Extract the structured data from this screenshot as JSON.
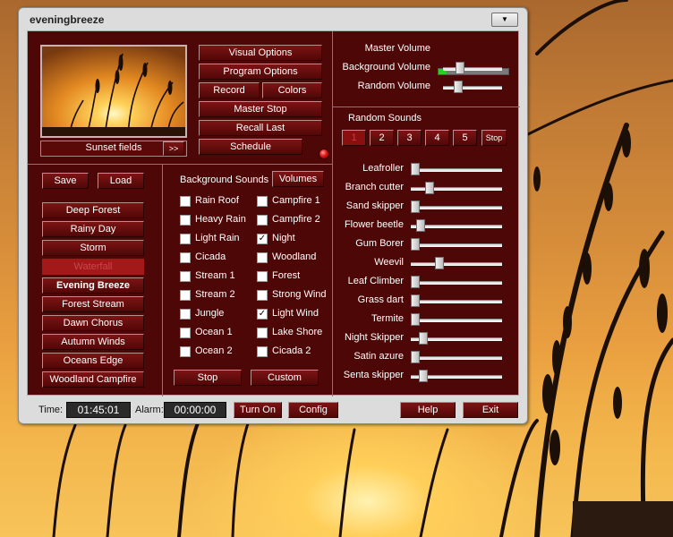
{
  "window": {
    "title": "eveningbreeze",
    "menu_glyph": "▼"
  },
  "preview": {
    "label": "Sunset fields",
    "next_label": ">>"
  },
  "options": {
    "visual": "Visual Options",
    "program": "Program Options",
    "record": "Record",
    "colors": "Colors",
    "master_stop": "Master Stop",
    "recall_last": "Recall Last",
    "schedule": "Schedule"
  },
  "volume": {
    "master_label": "Master Volume",
    "background_label": "Background Volume",
    "random_label": "Random Volume",
    "master_level": 0.12,
    "background_level": 0.25,
    "random_level": 0.22
  },
  "random_sounds": {
    "title": "Random Sounds",
    "presets": [
      "1",
      "2",
      "3",
      "4",
      "5"
    ],
    "stop_label": "Stop",
    "items": [
      {
        "label": "Leafroller",
        "level": 0.0
      },
      {
        "label": "Branch cutter",
        "level": 0.17
      },
      {
        "label": "Sand skipper",
        "level": 0.0
      },
      {
        "label": "Flower beetle",
        "level": 0.06
      },
      {
        "label": "Gum Borer",
        "level": 0.0
      },
      {
        "label": "Weevil",
        "level": 0.29
      },
      {
        "label": "Leaf Climber",
        "level": 0.0
      },
      {
        "label": "Grass dart",
        "level": 0.0
      },
      {
        "label": "Termite",
        "level": 0.0
      },
      {
        "label": "Night Skipper",
        "level": 0.1
      },
      {
        "label": "Satin azure",
        "level": 0.0
      },
      {
        "label": "Senta skipper",
        "level": 0.1
      }
    ]
  },
  "scenes": {
    "save": "Save",
    "load": "Load",
    "items": [
      {
        "label": "Deep Forest",
        "state": "normal"
      },
      {
        "label": "Rainy Day",
        "state": "normal"
      },
      {
        "label": "Storm",
        "state": "normal"
      },
      {
        "label": "Waterfall",
        "state": "disabled"
      },
      {
        "label": "Evening Breeze",
        "state": "active"
      },
      {
        "label": "Forest Stream",
        "state": "normal"
      },
      {
        "label": "Dawn Chorus",
        "state": "normal"
      },
      {
        "label": "Autumn Winds",
        "state": "normal"
      },
      {
        "label": "Oceans Edge",
        "state": "normal"
      },
      {
        "label": "Woodland Campfire",
        "state": "normal"
      }
    ]
  },
  "background_sounds": {
    "title": "Background Sounds",
    "volumes_label": "Volumes",
    "left": [
      {
        "label": "Rain Roof",
        "checked": false
      },
      {
        "label": "Heavy Rain",
        "checked": false
      },
      {
        "label": "Light Rain",
        "checked": false
      },
      {
        "label": "Cicada",
        "checked": false
      },
      {
        "label": "Stream 1",
        "checked": false
      },
      {
        "label": "Stream 2",
        "checked": false
      },
      {
        "label": "Jungle",
        "checked": false
      },
      {
        "label": "Ocean 1",
        "checked": false
      },
      {
        "label": "Ocean 2",
        "checked": false
      }
    ],
    "right": [
      {
        "label": "Campfire 1",
        "checked": false
      },
      {
        "label": "Campfire 2",
        "checked": false
      },
      {
        "label": "Night",
        "checked": true
      },
      {
        "label": "Woodland",
        "checked": false
      },
      {
        "label": "Forest",
        "checked": false
      },
      {
        "label": "Strong Wind",
        "checked": false
      },
      {
        "label": "Light Wind",
        "checked": true
      },
      {
        "label": "Lake Shore",
        "checked": false
      },
      {
        "label": "Cicada 2",
        "checked": false
      }
    ],
    "stop_label": "Stop",
    "custom_label": "Custom"
  },
  "status": {
    "time_label": "Time:",
    "time": "01:45:01",
    "alarm_label": "Alarm:",
    "alarm": "00:00:00",
    "turn_on": "Turn On",
    "config": "Config",
    "help": "Help",
    "exit": "Exit"
  },
  "colors": {
    "panel": "#4e0707",
    "button": "#6a0e0e",
    "master_fill": "#24d224",
    "led": "#e01515"
  }
}
